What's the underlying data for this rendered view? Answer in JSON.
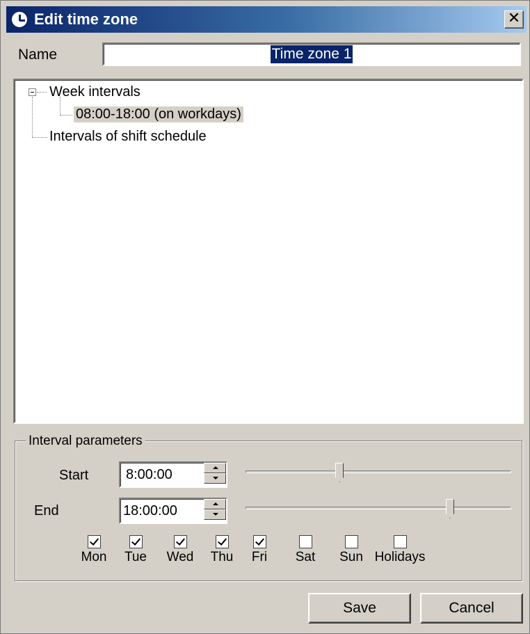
{
  "window": {
    "title": "Edit time zone",
    "close_glyph": "✕",
    "icon": "clock-icon"
  },
  "name": {
    "label": "Name",
    "value": "Time zone 1"
  },
  "tree": {
    "root": "Week intervals",
    "child": "08:00-18:00 (on workdays)",
    "second_root": "Intervals of shift schedule"
  },
  "params": {
    "group_title": "Interval parameters",
    "start_label": "Start",
    "start_value": "8:00:00",
    "end_label": "End",
    "end_value": "18:00:00"
  },
  "days": [
    {
      "label": "Mon",
      "checked": true
    },
    {
      "label": "Tue",
      "checked": true
    },
    {
      "label": "Wed",
      "checked": true
    },
    {
      "label": "Thu",
      "checked": true
    },
    {
      "label": "Fri",
      "checked": true
    },
    {
      "label": "Sat",
      "checked": false
    },
    {
      "label": "Sun",
      "checked": false
    },
    {
      "label": "Holidays",
      "checked": false
    }
  ],
  "buttons": {
    "save": "Save",
    "cancel": "Cancel"
  },
  "colors": {
    "title_start": "#0a246a",
    "title_end": "#a6caf0",
    "face": "#d4d0c8",
    "selection": "#0a246a"
  }
}
